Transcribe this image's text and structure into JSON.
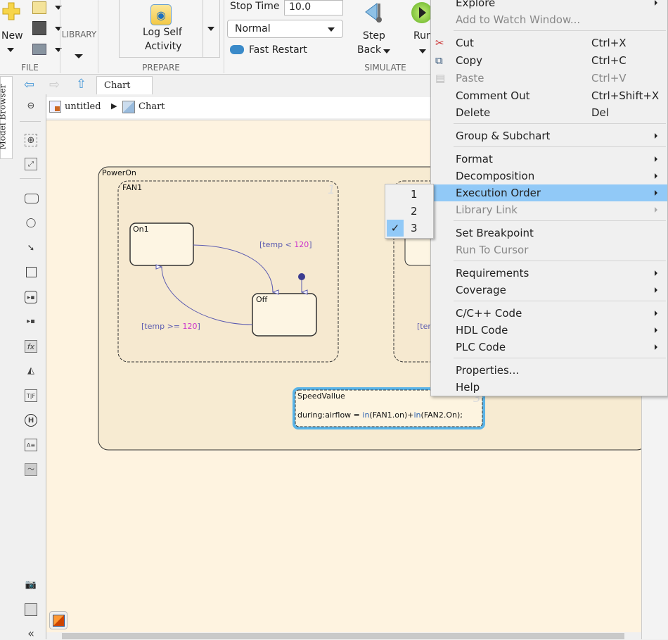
{
  "ribbon": {
    "file": {
      "new_label": "New",
      "section": "FILE"
    },
    "library": {
      "section": "LIBRARY"
    },
    "prepare": {
      "log_label_1": "Log Self",
      "log_label_2": "Activity",
      "section": "PREPARE"
    },
    "simulate": {
      "stop_time_label": "Stop Time",
      "stop_time_value": "10.0",
      "mode": "Normal",
      "fast_restart": "Fast Restart",
      "step_back_1": "Step",
      "step_back_2": "Back",
      "run": "Run",
      "section": "SIMULATE"
    }
  },
  "nav": {
    "tab": "Chart"
  },
  "model_browser": "Model Browser",
  "breadcrumb": {
    "root": "untitled",
    "child": "Chart"
  },
  "diagram": {
    "poweron": "PowerOn",
    "fan1": {
      "name": "FAN1",
      "order": "1"
    },
    "on1": "On1",
    "off": "Off",
    "t1_pre": "[temp < ",
    "t1_num": "120",
    "t1_post": "]",
    "t2_pre": "[temp >= ",
    "t2_num": "120",
    "t2_post": "]",
    "fan2_label_partial": "[tem",
    "speed": {
      "name": "SpeedVallue",
      "pre": "during:airflow = ",
      "in1": "in",
      "mid": "(FAN1.on)+",
      "in2": "in",
      "post": "(FAN2.On);",
      "order": "3"
    }
  },
  "context_menu": {
    "items": [
      {
        "label": "Explore",
        "submenu": true
      },
      {
        "label": "Add to Watch Window...",
        "disabled": true
      },
      {
        "label": "Cut",
        "shortcut": "Ctrl+X",
        "icon": "scissors-icon"
      },
      {
        "label": "Copy",
        "shortcut": "Ctrl+C",
        "icon": "copy-icon"
      },
      {
        "label": "Paste",
        "shortcut": "Ctrl+V",
        "disabled": true,
        "icon": "paste-icon"
      },
      {
        "label": "Comment Out",
        "shortcut": "Ctrl+Shift+X"
      },
      {
        "label": "Delete",
        "shortcut": "Del"
      },
      {
        "label": "Group & Subchart",
        "submenu": true
      },
      {
        "label": "Format",
        "submenu": true
      },
      {
        "label": "Decomposition",
        "submenu": true
      },
      {
        "label": "Execution Order",
        "submenu": true,
        "highlighted": true
      },
      {
        "label": "Library Link",
        "submenu": true,
        "disabled": true
      },
      {
        "label": "Set Breakpoint"
      },
      {
        "label": "Run To Cursor",
        "disabled": true
      },
      {
        "label": "Requirements",
        "submenu": true
      },
      {
        "label": "Coverage",
        "submenu": true
      },
      {
        "label": "C/C++ Code",
        "submenu": true
      },
      {
        "label": "HDL Code",
        "submenu": true
      },
      {
        "label": "PLC Code",
        "submenu": true
      },
      {
        "label": "Properties..."
      },
      {
        "label": "Help"
      }
    ]
  },
  "execution_order_submenu": {
    "items": [
      "1",
      "2",
      "3"
    ],
    "checked": "3"
  },
  "colors": {
    "highlight": "#91c9f7",
    "canvas": "#fef3e0",
    "transition": "#5a5ab0",
    "number": "#cc33cc",
    "selected_border": "#5ab4e8"
  }
}
